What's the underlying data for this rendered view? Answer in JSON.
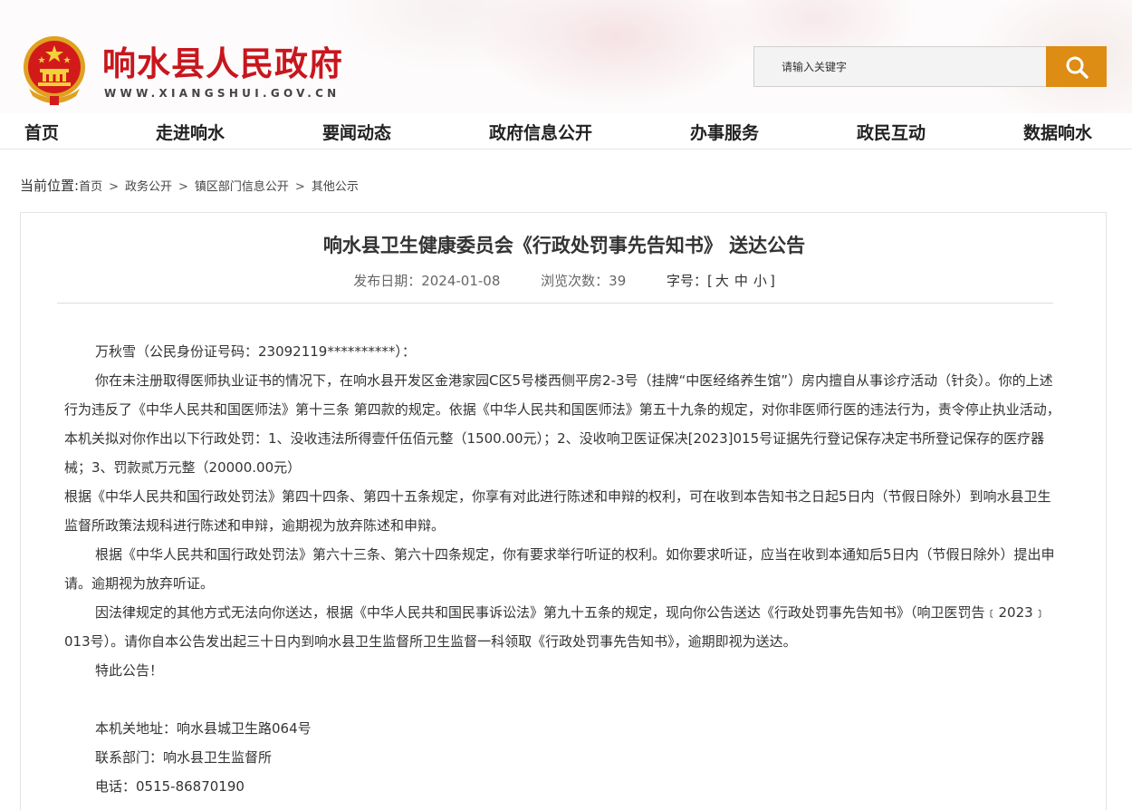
{
  "header": {
    "site_title": "响水县人民政府",
    "site_url": "WWW.XIANGSHUI.GOV.CN",
    "search_placeholder": "请输入关键字"
  },
  "nav": [
    "首页",
    "走进响水",
    "要闻动态",
    "政府信息公开",
    "办事服务",
    "政民互动",
    "数据响水"
  ],
  "breadcrumb": {
    "label": "当前位置:",
    "items": [
      "首页",
      "政务公开",
      "镇区部门信息公开",
      "其他公示"
    ],
    "separator": ">"
  },
  "article": {
    "title": "响水县卫生健康委员会《行政处罚事先告知书》 送达公告",
    "publish_date": "发布日期：2024-01-08",
    "views": "浏览次数：39",
    "font_size_label": "字号：[",
    "font_size_large": "大",
    "font_size_medium": "中",
    "font_size_small": "小",
    "font_size_close": "]",
    "paragraphs": [
      "万秋雪（公民身份证号码：23092119**********）：",
      "你在未注册取得医师执业证书的情况下，在响水县开发区金港家园C区5号楼西侧平房2-3号（挂牌“中医经络养生馆”）房内擅自从事诊疗活动（针灸）。你的上述行为违反了《中华人民共和国医师法》第十三条 第四款的规定。依据《中华人民共和国医师法》第五十九条的规定，对你非医师行医的违法行为，责令停止执业活动，本机关拟对你作出以下行政处罚：1、没收违法所得壹仟伍佰元整（1500.00元）；2、没收响卫医证保决[2023]015号证据先行登记保存决定书所登记保存的医疗器械；3、罚款贰万元整（20000.00元）",
      "根据《中华人民共和国行政处罚法》第四十四条、第四十五条规定，你享有对此进行陈述和申辩的权利，可在收到本告知书之日起5日内（节假日除外）到响水县卫生监督所政策法规科进行陈述和申辩，逾期视为放弃陈述和申辩。",
      "根据《中华人民共和国行政处罚法》第六十三条、第六十四条规定，你有要求举行听证的权利。如你要求听证，应当在收到本通知后5日内（节假日除外）提出申请。逾期视为放弃听证。",
      "因法律规定的其他方式无法向你送达，根据《中华人民共和国民事诉讼法》第九十五条的规定，现向你公告送达《行政处罚事先告知书》（响卫医罚告﹝2023﹞013号）。请你自本公告发出起三十日内到响水县卫生监督所卫生监督一科领取《行政处罚事先告知书》，逾期即视为送达。",
      "特此公告！",
      "",
      "本机关地址：响水县城卫生路064号",
      "联系部门：响水县卫生监督所",
      "电话：0515-86870190"
    ]
  },
  "colors": {
    "brand_red": "#c8161d",
    "search_orange": "#dd8c14"
  },
  "icons": [
    "national-emblem-icon",
    "search-icon"
  ]
}
